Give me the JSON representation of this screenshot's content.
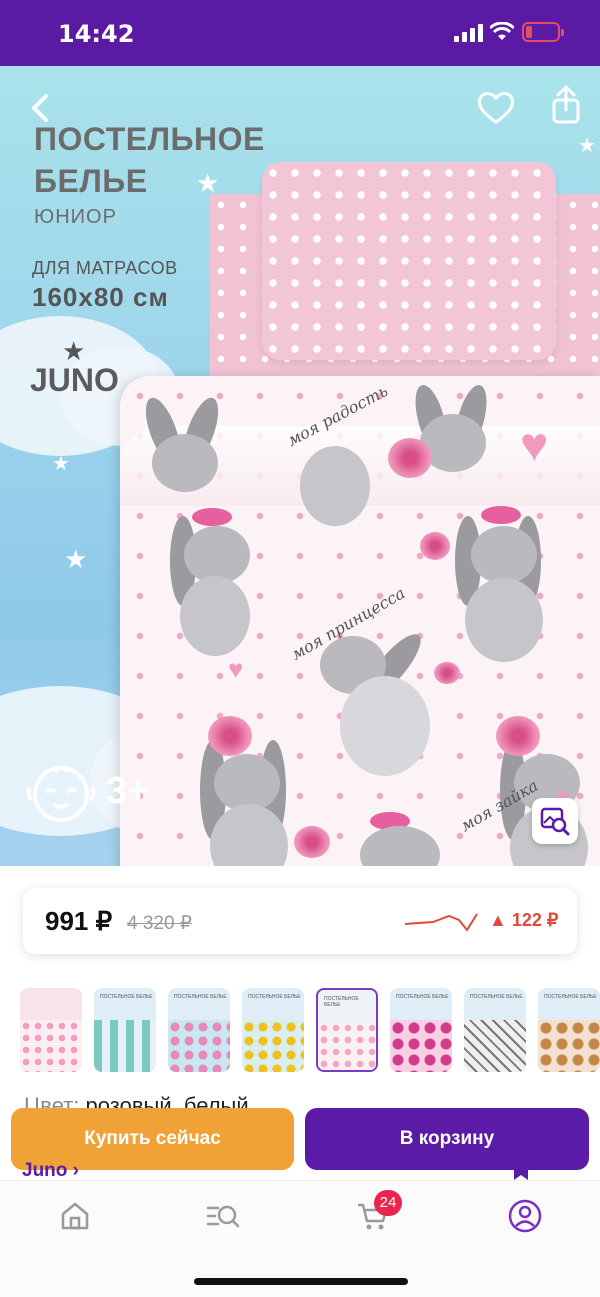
{
  "status_bar": {
    "time": "14:42"
  },
  "hero": {
    "title_line1": "ПОСТЕЛЬНОЕ",
    "title_line2": "БЕЛЬЕ",
    "subtitle": "ЮНИОР",
    "mattress_label": "ДЛЯ МАТРАСОВ",
    "mattress_size": "160x80 см",
    "brand": "JUNO",
    "age": "3+",
    "script_text": [
      "моя радость",
      "моя принцесса",
      "моя зайка"
    ]
  },
  "price": {
    "current": "991 ₽",
    "old": "4 320 ₽",
    "change": "▲ 122 ₽",
    "trend_color": "#e04a3a"
  },
  "thumbnails": {
    "label": "ПОСТЕЛЬНОЕ БЕЛЬЕ",
    "selected_index": 4
  },
  "color": {
    "label": "Цвет:",
    "value": "розовый, белый"
  },
  "actions": {
    "buy_now": "Купить сейчас",
    "add_to_cart": "В корзину"
  },
  "brand_link": "Juno ›",
  "nav": {
    "cart_badge": "24"
  },
  "colors": {
    "brand_purple": "#5b1ba6",
    "accent_orange": "#f0a236",
    "badge_red": "#e8254e"
  }
}
